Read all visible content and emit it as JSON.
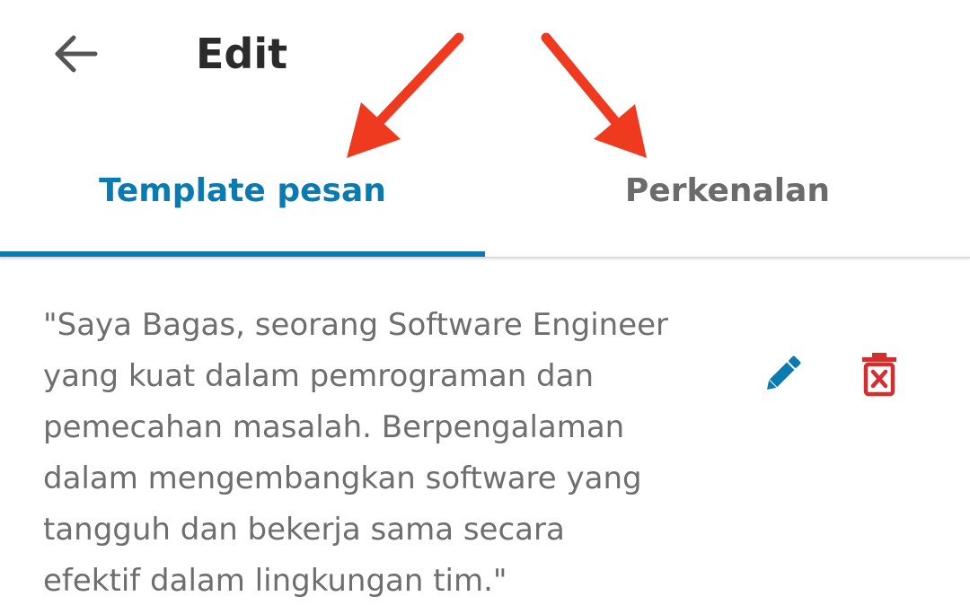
{
  "header": {
    "back_icon": "arrow-left-icon",
    "title": "Edit"
  },
  "tabs": [
    {
      "label": "Template pesan",
      "selected": true
    },
    {
      "label": "Perkenalan",
      "selected": false
    }
  ],
  "template_item": {
    "text": "\"Saya Bagas, seorang Software Engineer\nyang kuat dalam pemrograman dan\npemecahan masalah. Berpengalaman\ndalam mengembangkan software yang\ntangguh dan bekerja sama secara\nefektif dalam lingkungan tim.\"",
    "edit_icon": "pencil-icon",
    "delete_icon": "trash-icon"
  },
  "colors": {
    "accent": "#0a7bb0",
    "inactive_tab": "#6b6b6b",
    "delete": "#d32f2f",
    "annotation_arrow": "#f03a1f"
  }
}
